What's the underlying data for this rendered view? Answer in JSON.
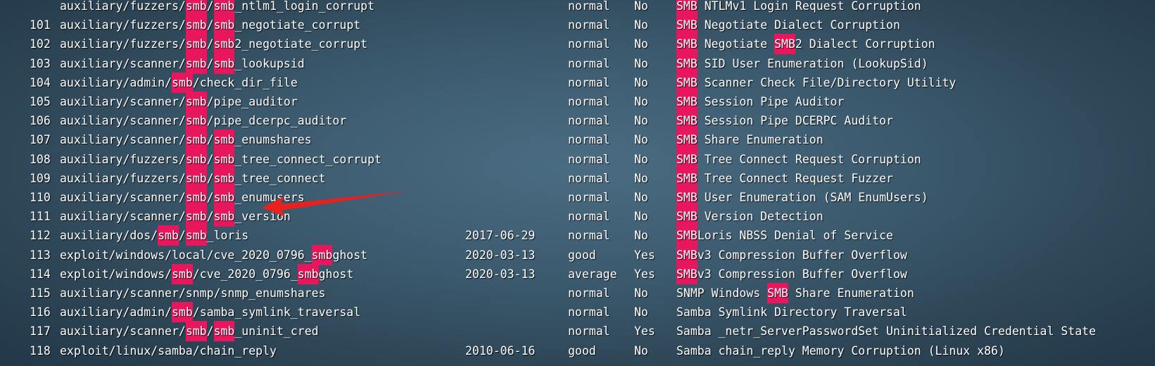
{
  "terminal": {
    "search_term": "smb",
    "highlight_color": "#e8175d",
    "arrow_color": "#e8211f",
    "rows": [
      {
        "num": "",
        "name": "auxiliary/fuzzers/smb/smb_ntlm1_login_corrupt",
        "date": "",
        "rank": "normal",
        "check": "No",
        "desc": "SMB NTLMv1 Login Request Corruption"
      },
      {
        "num": "101",
        "name": "auxiliary/fuzzers/smb/smb_negotiate_corrupt",
        "date": "",
        "rank": "normal",
        "check": "No",
        "desc": "SMB Negotiate Dialect Corruption"
      },
      {
        "num": "102",
        "name": "auxiliary/fuzzers/smb/smb2_negotiate_corrupt",
        "date": "",
        "rank": "normal",
        "check": "No",
        "desc": "SMB Negotiate SMB2 Dialect Corruption"
      },
      {
        "num": "103",
        "name": "auxiliary/scanner/smb/smb_lookupsid",
        "date": "",
        "rank": "normal",
        "check": "No",
        "desc": "SMB SID User Enumeration (LookupSid)"
      },
      {
        "num": "104",
        "name": "auxiliary/admin/smb/check_dir_file",
        "date": "",
        "rank": "normal",
        "check": "No",
        "desc": "SMB Scanner Check File/Directory Utility"
      },
      {
        "num": "105",
        "name": "auxiliary/scanner/smb/pipe_auditor",
        "date": "",
        "rank": "normal",
        "check": "No",
        "desc": "SMB Session Pipe Auditor"
      },
      {
        "num": "106",
        "name": "auxiliary/scanner/smb/pipe_dcerpc_auditor",
        "date": "",
        "rank": "normal",
        "check": "No",
        "desc": "SMB Session Pipe DCERPC Auditor"
      },
      {
        "num": "107",
        "name": "auxiliary/scanner/smb/smb_enumshares",
        "date": "",
        "rank": "normal",
        "check": "No",
        "desc": "SMB Share Enumeration"
      },
      {
        "num": "108",
        "name": "auxiliary/fuzzers/smb/smb_tree_connect_corrupt",
        "date": "",
        "rank": "normal",
        "check": "No",
        "desc": "SMB Tree Connect Request Corruption"
      },
      {
        "num": "109",
        "name": "auxiliary/fuzzers/smb/smb_tree_connect",
        "date": "",
        "rank": "normal",
        "check": "No",
        "desc": "SMB Tree Connect Request Fuzzer"
      },
      {
        "num": "110",
        "name": "auxiliary/scanner/smb/smb_enumusers",
        "date": "",
        "rank": "normal",
        "check": "No",
        "desc": "SMB User Enumeration (SAM EnumUsers)"
      },
      {
        "num": "111",
        "name": "auxiliary/scanner/smb/smb_version",
        "date": "",
        "rank": "normal",
        "check": "No",
        "desc": "SMB Version Detection"
      },
      {
        "num": "112",
        "name": "auxiliary/dos/smb/smb_loris",
        "date": "2017-06-29",
        "rank": "normal",
        "check": "No",
        "desc": "SMBLoris NBSS Denial of Service"
      },
      {
        "num": "113",
        "name": "exploit/windows/local/cve_2020_0796_smbghost",
        "date": "2020-03-13",
        "rank": "good",
        "check": "Yes",
        "desc": "SMBv3 Compression Buffer Overflow"
      },
      {
        "num": "114",
        "name": "exploit/windows/smb/cve_2020_0796_smbghost",
        "date": "2020-03-13",
        "rank": "average",
        "check": "Yes",
        "desc": "SMBv3 Compression Buffer Overflow"
      },
      {
        "num": "115",
        "name": "auxiliary/scanner/snmp/snmp_enumshares",
        "date": "",
        "rank": "normal",
        "check": "No",
        "desc": "SNMP Windows SMB Share Enumeration"
      },
      {
        "num": "116",
        "name": "auxiliary/admin/smb/samba_symlink_traversal",
        "date": "",
        "rank": "normal",
        "check": "No",
        "desc": "Samba Symlink Directory Traversal"
      },
      {
        "num": "117",
        "name": "auxiliary/scanner/smb/smb_uninit_cred",
        "date": "",
        "rank": "normal",
        "check": "Yes",
        "desc": "Samba _netr_ServerPasswordSet Uninitialized Credential State"
      },
      {
        "num": "118",
        "name": "exploit/linux/samba/chain_reply",
        "date": "2010-06-16",
        "rank": "good",
        "check": "No",
        "desc": "Samba chain_reply Memory Corruption (Linux x86)"
      }
    ]
  }
}
